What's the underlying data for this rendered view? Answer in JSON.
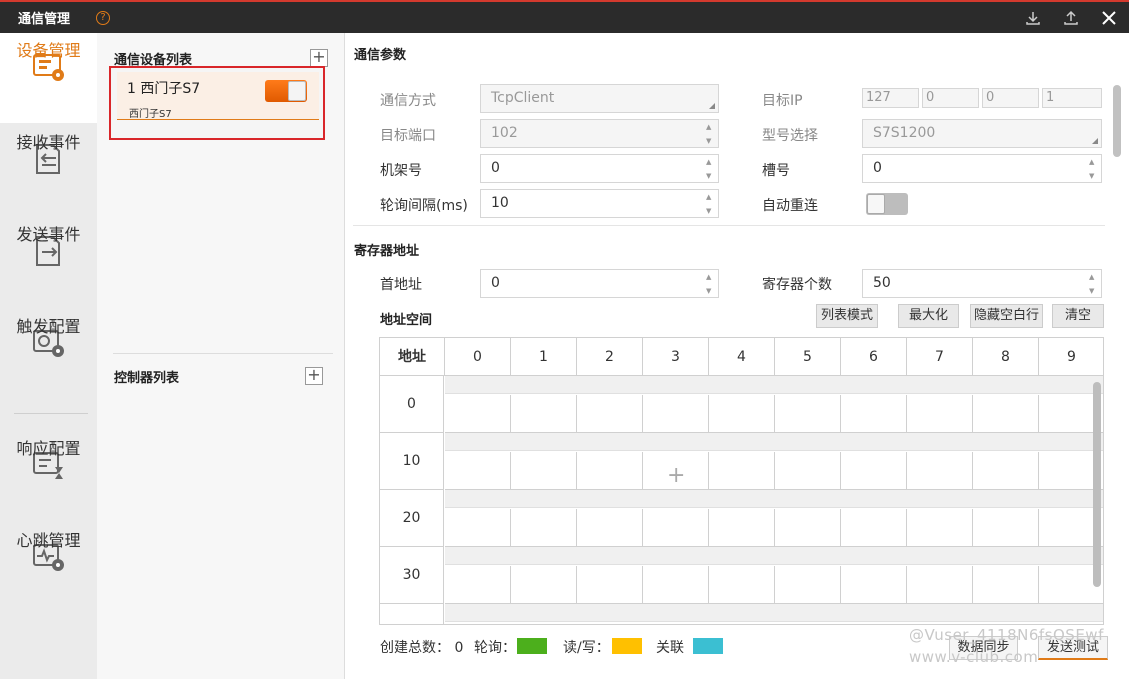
{
  "window": {
    "title": "通信管理",
    "help_icon": "?"
  },
  "nav": {
    "items": [
      {
        "label": "设备管理",
        "icon": "device-icon",
        "active": true
      },
      {
        "label": "接收事件",
        "icon": "receive-icon"
      },
      {
        "label": "发送事件",
        "icon": "send-icon"
      },
      {
        "label": "触发配置",
        "icon": "trigger-icon"
      },
      {
        "label": "响应配置",
        "icon": "response-icon"
      },
      {
        "label": "心跳管理",
        "icon": "heartbeat-icon"
      }
    ]
  },
  "device_panel": {
    "title": "通信设备列表",
    "device": {
      "name": "1 西门子S7",
      "sub": "西门子S7",
      "enabled": true
    },
    "controllers_title": "控制器列表"
  },
  "params": {
    "title": "通信参数",
    "comm_mode_label": "通信方式",
    "comm_mode_value": "TcpClient",
    "target_ip_label": "目标IP",
    "ip": [
      "127",
      "0",
      "0",
      "1"
    ],
    "target_port_label": "目标端口",
    "target_port_value": "102",
    "model_label": "型号选择",
    "model_value": "S7S1200",
    "rack_label": "机架号",
    "rack_value": "0",
    "slot_label": "槽号",
    "slot_value": "0",
    "poll_label": "轮询间隔(ms)",
    "poll_value": "10",
    "reconnect_label": "自动重连",
    "reconnect_enabled": false
  },
  "registers": {
    "title": "寄存器地址",
    "start_label": "首地址",
    "start_value": "0",
    "count_label": "寄存器个数",
    "count_value": "50",
    "space_title": "地址空间",
    "buttons": [
      "列表模式",
      "最大化",
      "隐藏空白行",
      "清空"
    ],
    "columns": [
      "地址",
      "0",
      "1",
      "2",
      "3",
      "4",
      "5",
      "6",
      "7",
      "8",
      "9"
    ],
    "rows": [
      "0",
      "10",
      "20",
      "30"
    ]
  },
  "footer": {
    "total_label": "创建总数：",
    "total_value": "0",
    "poll_label": "轮询：",
    "rw_label": "读/写：",
    "link_label": "关联",
    "colors": {
      "poll": "#4caf1c",
      "rw": "#ffc000",
      "link": "#3bbfd2"
    },
    "sync_button": "数据同步",
    "send_test_button": "发送测试"
  },
  "watermark": {
    "line1": "@Vuser_4118N6fsQSEwf",
    "line2": "www.v-club.com"
  }
}
